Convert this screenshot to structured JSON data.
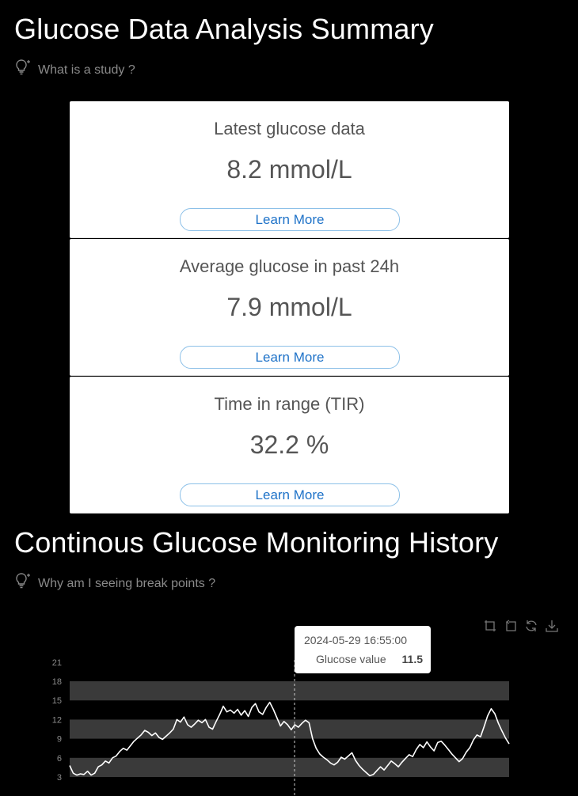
{
  "summary": {
    "title": "Glucose Data Analysis Summary",
    "hint": "What is a study ?",
    "cards": [
      {
        "title": "Latest glucose data",
        "value": "8.2 mmol/L",
        "button": "Learn More"
      },
      {
        "title": "Average glucose in past 24h",
        "value": "7.9 mmol/L",
        "button": "Learn More"
      },
      {
        "title": "Time in range (TIR)",
        "value": "32.2 %",
        "button": "Learn More"
      }
    ]
  },
  "history": {
    "title": "Continous Glucose Monitoring History",
    "hint": "Why am I seeing break points ?",
    "toolbox": [
      "zoom-icon",
      "zoom-reset-icon",
      "restore-icon",
      "save-image-icon"
    ],
    "tooltip": {
      "date": "2024-05-29 16:55:00",
      "name": "Glucose value",
      "value": "11.5"
    }
  },
  "colors": {
    "background": "#000000",
    "card": "#ffffff",
    "link": "#1e72c8",
    "band": "#3a3a3a",
    "line": "#ffffff"
  },
  "chart_data": {
    "type": "line",
    "y_ticks": [
      "3",
      "6",
      "9",
      "12",
      "15",
      "18",
      "21"
    ],
    "ylim": [
      3,
      21
    ],
    "bands": [
      [
        3,
        6
      ],
      [
        9,
        12
      ],
      [
        15,
        18
      ]
    ],
    "series": [
      {
        "values": [
          4.8,
          3.6,
          3.3,
          3.5,
          3.4,
          3.9,
          3.3,
          3.6,
          4.6,
          4.9,
          5.5,
          5.2,
          6.0,
          6.3,
          7.0,
          7.5,
          7.2,
          7.9,
          8.6,
          9.1,
          9.6,
          10.3,
          10.0,
          9.5,
          9.9,
          9.2,
          8.9,
          9.4,
          9.9,
          10.5,
          12.0,
          11.6,
          12.4,
          11.2,
          10.8,
          11.3,
          11.9,
          11.5,
          12.0,
          10.8,
          10.5,
          11.7,
          12.8,
          14.1,
          13.2,
          13.5,
          13.0,
          13.6,
          12.7,
          13.4,
          12.5,
          13.9,
          14.5,
          13.2,
          12.8,
          13.9,
          14.7,
          13.6,
          12.3,
          11.0,
          11.7,
          11.2,
          10.4,
          11.2,
          10.8,
          11.4,
          11.9,
          11.5,
          9.0,
          7.5,
          6.6,
          6.1,
          5.7,
          5.2,
          4.9,
          5.3,
          6.1,
          5.8,
          6.3,
          6.8,
          5.6,
          4.8,
          4.2,
          3.7,
          3.2,
          3.4,
          4.0,
          4.6,
          4.1,
          4.8,
          5.5,
          5.1,
          4.6,
          5.3,
          5.9,
          6.5,
          6.2,
          7.3,
          8.1,
          7.6,
          8.5,
          7.7,
          7.1,
          8.4,
          8.6,
          8.0,
          7.3,
          6.6,
          6.0,
          5.4,
          5.9,
          6.9,
          7.6,
          8.8,
          9.6,
          9.3,
          10.9,
          12.6,
          13.7,
          12.9,
          11.4,
          10.2,
          9.1,
          8.2
        ]
      }
    ],
    "marker_date": "2024-05-29 16:55:00"
  }
}
